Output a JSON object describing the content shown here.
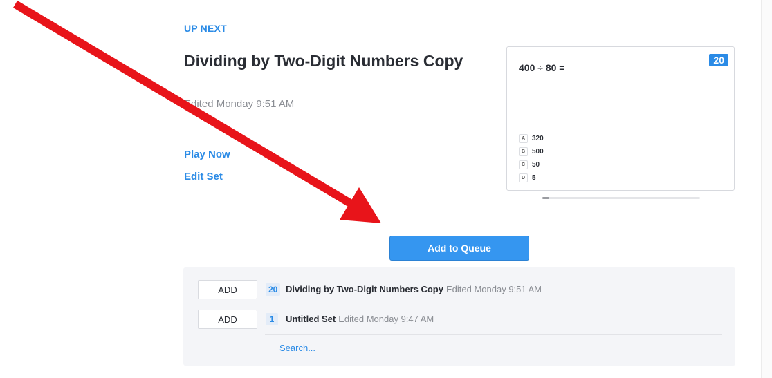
{
  "header": {
    "up_next": "UP NEXT",
    "set_title": "Dividing by Two-Digit Numbers Copy",
    "edited": "Edited Monday 9:51 AM"
  },
  "actions": {
    "play_now": "Play Now",
    "edit_set": "Edit Set",
    "add_to_queue": "Add to Queue"
  },
  "preview": {
    "question": "400 ÷ 80 =",
    "question_count": "20",
    "answers": [
      {
        "letter": "A",
        "text": "320"
      },
      {
        "letter": "B",
        "text": "500"
      },
      {
        "letter": "C",
        "text": "50"
      },
      {
        "letter": "D",
        "text": "5"
      }
    ]
  },
  "queue": {
    "rows": [
      {
        "add_label": "ADD",
        "count": "20",
        "title": "Dividing by Two-Digit Numbers Copy",
        "meta": "Edited Monday 9:51 AM"
      },
      {
        "add_label": "ADD",
        "count": "1",
        "title": "Untitled Set",
        "meta": "Edited Monday 9:47 AM"
      }
    ],
    "search_label": "Search..."
  },
  "colors": {
    "accent": "#2b8be6",
    "button": "#3596f0",
    "annotation_arrow": "#e8141a"
  },
  "icons": {
    "annotation": "red-arrow-icon"
  }
}
